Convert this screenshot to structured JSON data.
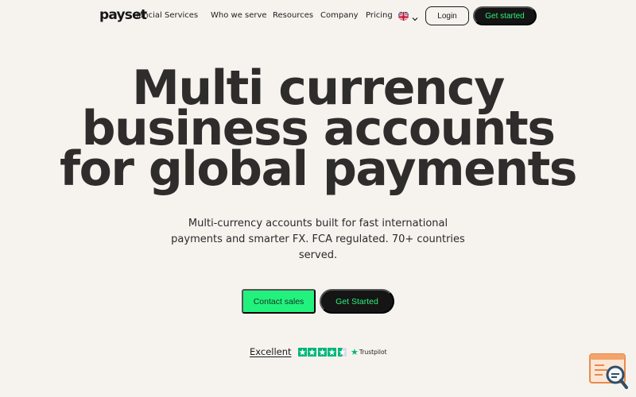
{
  "brand": {
    "logo_text": "payset"
  },
  "nav": {
    "links": [
      {
        "label": "Financial Services"
      },
      {
        "label": "Who we serve"
      },
      {
        "label": "Resources"
      },
      {
        "label": "Company"
      },
      {
        "label": "Pricing"
      }
    ],
    "language_icon": "uk-flag-icon",
    "login_label": "Login",
    "get_started_label": "Get started"
  },
  "hero": {
    "headline_lines": [
      "Multi currency",
      "business accounts",
      "for global payments"
    ],
    "subtitle": "Multi-currency accounts built for fast international payments and smarter FX. FCA regulated. 70+ countries served.",
    "contact_label": "Contact sales",
    "get_started_label": "Get Started"
  },
  "trustpilot": {
    "rating_word": "Excellent",
    "stars_filled": 4.5,
    "stars_total": 5,
    "brand": "Trustpilot"
  },
  "colors": {
    "background": "#f6f3ef",
    "accent_green": "#22f27d",
    "dark": "#141414",
    "trustpilot_green": "#00b67a"
  },
  "widget": {
    "icon": "search-chat-icon"
  }
}
